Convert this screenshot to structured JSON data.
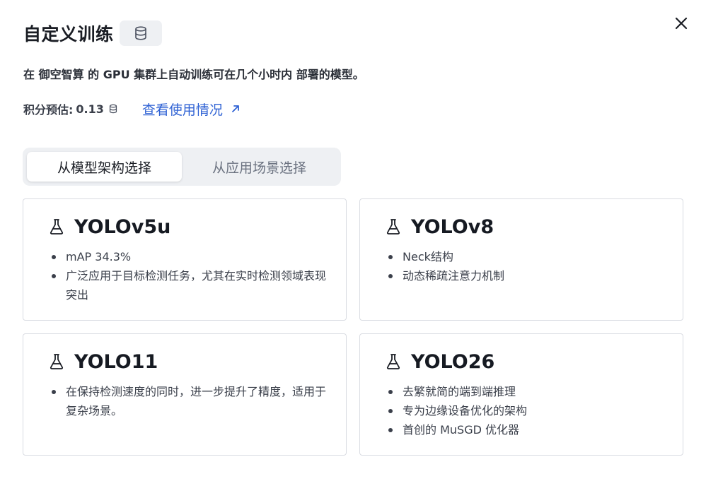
{
  "dialog": {
    "title": "自定义训练",
    "subtitle": "在 御空智算 的 GPU 集群上自动训练可在几个小时内 部署的模型。",
    "credits_label": "积分预估:",
    "credits_value": "0.13",
    "usage_link": "查看使用情况",
    "icons": {
      "close": "close-icon",
      "database": "database-icon",
      "external_link": "external-link-icon",
      "flask": "flask-icon"
    }
  },
  "tabs": [
    {
      "label": "从模型架构选择",
      "active": true
    },
    {
      "label": "从应用场景选择",
      "active": false
    }
  ],
  "models": [
    {
      "name": "YOLOv5u",
      "features": [
        "mAP 34.3%",
        "广泛应用于目标检测任务，尤其在实时检测领域表现突出"
      ]
    },
    {
      "name": "YOLOv8",
      "features": [
        "Neck结构",
        "动态稀疏注意力机制"
      ]
    },
    {
      "name": "YOLO11",
      "features": [
        "在保持检测速度的同时，进一步提升了精度，适用于复杂场景。"
      ]
    },
    {
      "name": "YOLO26",
      "features": [
        "去繁就简的端到端推理",
        "专为边缘设备优化的架构",
        "首创的 MuSGD 优化器"
      ]
    }
  ],
  "colors": {
    "link": "#2f62d4",
    "text": "#1a1d24",
    "muted": "#6b7280",
    "tab_bg": "#eef0f3",
    "card_border": "#d9dce2"
  }
}
